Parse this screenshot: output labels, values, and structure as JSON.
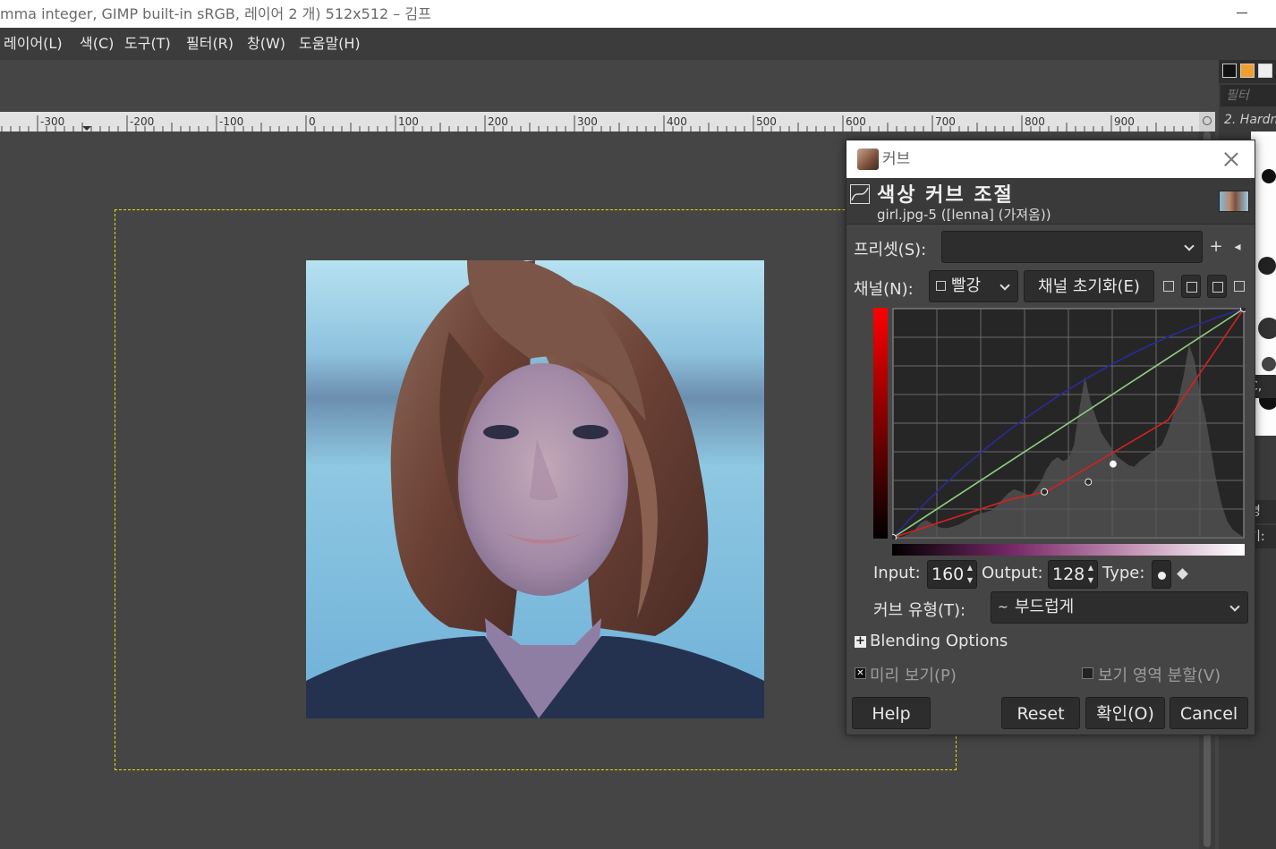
{
  "window": {
    "title": "mma integer, GIMP built-in sRGB, 레이어 2 개) 512x512 – 김프"
  },
  "menubar": {
    "items": [
      "레이어(L)",
      "색(C)",
      "도구(T)",
      "필터(R)",
      "창(W)",
      "도움말(H)"
    ]
  },
  "ruler": {
    "labels": [
      "-300",
      "-200",
      "-100",
      "0",
      "100",
      "200",
      "300",
      "400",
      "500",
      "600",
      "700",
      "800",
      "900"
    ]
  },
  "dock": {
    "filter_placeholder": "필터",
    "brush_name": "2. Hardn",
    "row_labels": [
      "C,",
      "명",
      "기:"
    ]
  },
  "dialog": {
    "title": "커브",
    "heading": "색상 커브 조절",
    "subtitle": "girl.jpg-5 ([lenna] (가져옴))",
    "presets_label": "프리셋(S):",
    "presets_value": "",
    "channel_label": "채널(N):",
    "channel_value": "빨강",
    "reset_channel_label": "채널 초기화(E)",
    "input_label": "Input:",
    "input_value": "160",
    "output_label": "Output:",
    "output_value": "128",
    "type_label": "Type:",
    "curve_type_label": "커브 유형(T):",
    "curve_type_value": "부드럽게",
    "blending_label": "Blending Options",
    "preview_label": "미리 보기(P)",
    "split_view_label": "보기 영역 분할(V)",
    "buttons": {
      "help": "Help",
      "reset": "Reset",
      "ok": "확인(O)",
      "cancel": "Cancel"
    },
    "curves": {
      "red_points": [
        [
          0,
          0
        ],
        [
          86,
          43
        ],
        [
          111,
          51
        ],
        [
          126,
          64
        ],
        [
          200,
          131
        ],
        [
          200,
          131
        ],
        [
          255,
          255
        ]
      ],
      "colors": {
        "red": "#d62020",
        "green": "#8fcf80",
        "blue": "#2a2a9a"
      }
    }
  }
}
